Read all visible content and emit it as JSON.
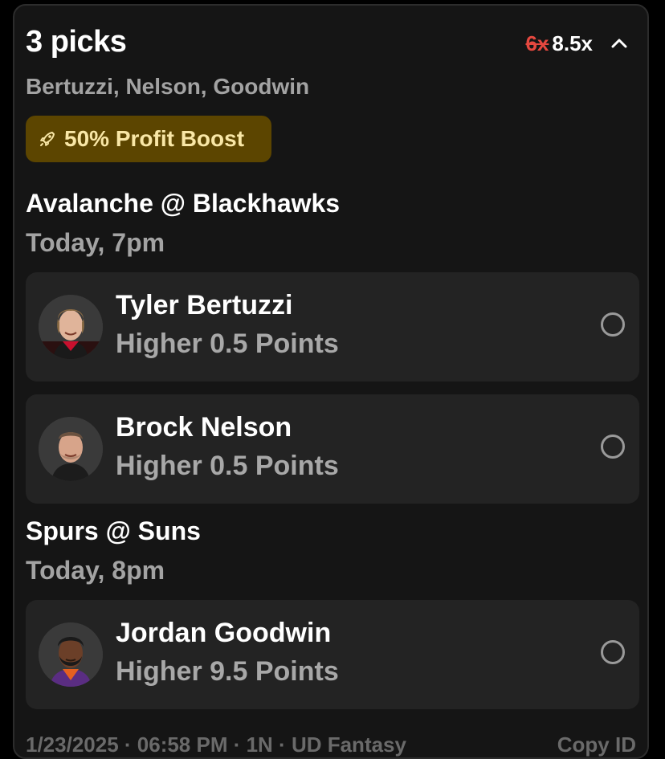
{
  "card": {
    "title": "3 picks",
    "multiplier_old": "6x",
    "multiplier_new": "8.5x",
    "subtitle": "Bertuzzi, Nelson, Goodwin",
    "boost_label": "50% Profit Boost",
    "footer_left": "1/23/2025 · 06:58 PM · 1N · UD Fantasy",
    "footer_right": "Copy ID"
  },
  "games": [
    {
      "title": "Avalanche @ Blackhawks",
      "time": "Today, 7pm",
      "picks": [
        {
          "player": "Tyler Bertuzzi",
          "line": "Higher 0.5 Points"
        },
        {
          "player": "Brock Nelson",
          "line": "Higher 0.5 Points"
        }
      ]
    },
    {
      "title": "Spurs @ Suns",
      "time": "Today, 8pm",
      "picks": [
        {
          "player": "Jordan Goodwin",
          "line": "Higher 9.5 Points"
        }
      ]
    }
  ],
  "colors": {
    "background": "#000000",
    "card": "#151515",
    "pick_card": "#232323",
    "strike": "#e5483f",
    "boost_bg": "#5c4500",
    "boost_text": "#f9e7a6",
    "muted_text": "#a3a3a3"
  },
  "icons": {
    "collapse": "chevron-up-icon",
    "boost": "rocket-icon",
    "pick_status": "radio-circle-icon"
  }
}
